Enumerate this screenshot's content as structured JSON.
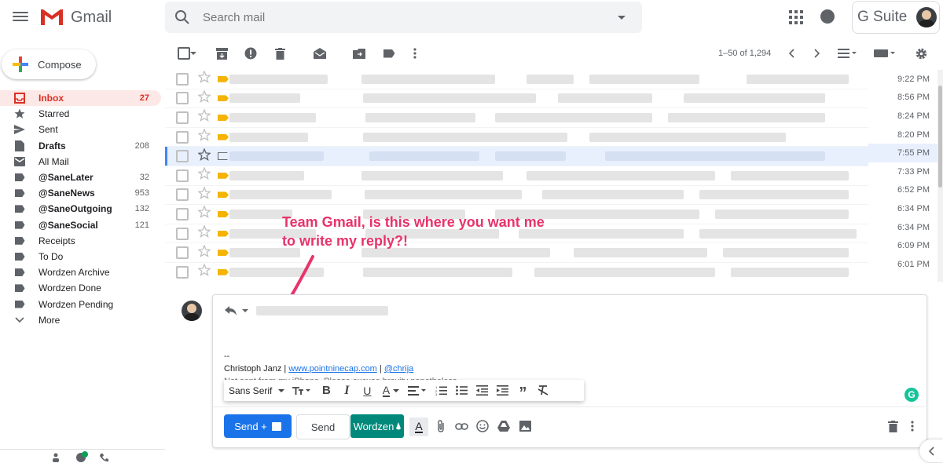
{
  "header": {
    "logo_text": "Gmail",
    "search_placeholder": "Search mail",
    "gsuite_text": "G Suite"
  },
  "compose": {
    "label": "Compose"
  },
  "sidebar": {
    "items": [
      {
        "label": "Inbox",
        "count": "27"
      },
      {
        "label": "Starred",
        "count": ""
      },
      {
        "label": "Sent",
        "count": ""
      },
      {
        "label": "Drafts",
        "count": "208"
      },
      {
        "label": "All Mail",
        "count": ""
      },
      {
        "label": "@SaneLater",
        "count": "32"
      },
      {
        "label": "@SaneNews",
        "count": "953"
      },
      {
        "label": "@SaneOutgoing",
        "count": "132"
      },
      {
        "label": "@SaneSocial",
        "count": "121"
      },
      {
        "label": "Receipts",
        "count": ""
      },
      {
        "label": "To Do",
        "count": ""
      },
      {
        "label": "Wordzen Archive",
        "count": ""
      },
      {
        "label": "Wordzen Done",
        "count": ""
      },
      {
        "label": "Wordzen Pending",
        "count": ""
      },
      {
        "label": "More",
        "count": ""
      }
    ]
  },
  "toolbar": {
    "range": "1–50 of 1,294"
  },
  "emails": {
    "times": [
      "9:22 PM",
      "8:56 PM",
      "8:24 PM",
      "8:20 PM",
      "7:55 PM",
      "7:33 PM",
      "6:52 PM",
      "6:34 PM",
      "6:34 PM",
      "6:09 PM",
      "6:01 PM"
    ],
    "selected_index": 4
  },
  "annotation": {
    "line1": "Team Gmail, is this where you want me",
    "line2": "to write my reply?!",
    "color": "#e8336b"
  },
  "reply": {
    "sig_dash": "--",
    "sig_name": "Christoph Janz | ",
    "sig_link": "www.pointninecap.com",
    "sig_sep": " | ",
    "sig_handle": "@chrija",
    "sig_line2": "Not sent from my iPhone. Please excuse brevity nonetheless.",
    "font_name": "Sans Serif",
    "send_label": "Send +",
    "send2_label": "Send",
    "wordzen_label": "Wordzen"
  },
  "colors": {
    "accent_blue": "#1a73e8",
    "gmail_red": "#d93025",
    "wordzen": "#00897b"
  }
}
